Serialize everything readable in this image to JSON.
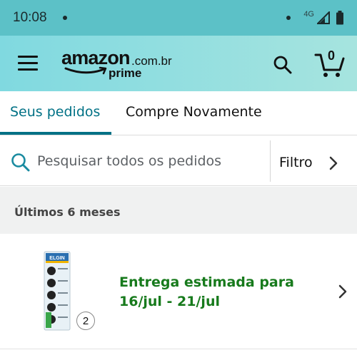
{
  "status_bar": {
    "time": "10:08",
    "network": "4G"
  },
  "app_bar": {
    "logo_word": "amazon",
    "logo_tld": ".com.br",
    "logo_prime": "prime",
    "cart_count": "0",
    "icons": {
      "menu": "hamburger-menu-icon",
      "search": "search-icon",
      "cart": "cart-icon"
    }
  },
  "tabs": [
    {
      "label": "Seus pedidos",
      "active": true
    },
    {
      "label": "Compre Novamente",
      "active": false
    }
  ],
  "search": {
    "placeholder": "Pesquisar todos os pedidos",
    "value": "",
    "filter_label": "Filtro"
  },
  "orders_section": {
    "title": "Últimos 6 meses"
  },
  "orders": [
    {
      "product_brand": "ELGIN",
      "quantity": "2",
      "delivery_line1": "Entrega estimada para",
      "delivery_line2": "16/jul - 21/jul"
    }
  ],
  "colors": {
    "status_bar": "#5cc1c7",
    "app_bar_start": "#80d9e0",
    "app_bar_end": "#a6e4df",
    "accent": "#007185",
    "delivery_green": "#177a1c",
    "section_bg": "#f0f1f1"
  }
}
